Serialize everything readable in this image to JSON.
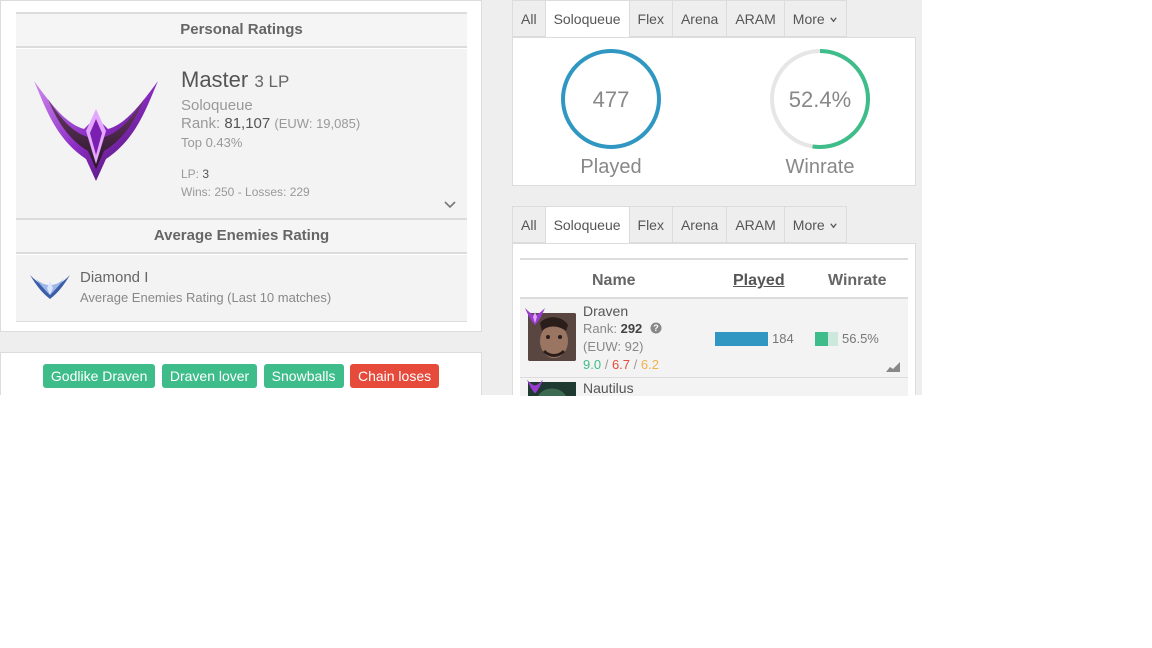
{
  "personal": {
    "title": "Personal Ratings",
    "tier": "Master",
    "lp_short": "3 LP",
    "queue": "Soloqueue",
    "rank_label": "Rank:",
    "rank_value": "81,107",
    "rank_region": "(EUW: 19,085)",
    "top": "Top 0.43%",
    "lp_label": "LP:",
    "lp_value": "3",
    "record": "Wins: 250 - Losses: 229"
  },
  "average": {
    "title": "Average Enemies Rating",
    "tier": "Diamond I",
    "subtitle": "Average Enemies Rating (Last 10 matches)"
  },
  "tags": [
    {
      "label": "Godlike Draven",
      "color": "#3ebd8a"
    },
    {
      "label": "Draven lover",
      "color": "#3ebd8a"
    },
    {
      "label": "Snowballs",
      "color": "#3ebd8a"
    },
    {
      "label": "Chain loses",
      "color": "#e64a3a"
    }
  ],
  "tabs_top": [
    "All",
    "Soloqueue",
    "Flex",
    "Arena",
    "ARAM",
    "More"
  ],
  "tabs_bottom": [
    "All",
    "Soloqueue",
    "Flex",
    "Arena",
    "ARAM",
    "More"
  ],
  "stats": {
    "played_value": "477",
    "played_label": "Played",
    "winrate_value": "52.4%",
    "winrate_fraction": 0.524,
    "winrate_label": "Winrate"
  },
  "table": {
    "col_name": "Name",
    "col_played": "Played",
    "col_winrate": "Winrate",
    "rows": [
      {
        "name": "Draven",
        "rank_label": "Rank:",
        "rank_value": "292",
        "region": "(EUW: 92)",
        "kills": "9.0",
        "deaths": "6.7",
        "assists": "6.2",
        "sep": "/",
        "played": "184",
        "played_fraction": 1.0,
        "winrate": "56.5%",
        "winrate_fraction": 0.565
      },
      {
        "name": "Nautilus"
      }
    ]
  },
  "colors": {
    "accent_blue": "#2f97c1",
    "accent_green": "#3ebd8a",
    "red": "#e64a3a",
    "kills": "#3ebd8a",
    "deaths": "#e64a3a",
    "assists": "#f0b14c"
  },
  "icons": {
    "more": "chevron-down-icon",
    "expand": "chevron-down-icon",
    "help": "question-circle-icon",
    "trend": "trend-chart-icon"
  }
}
